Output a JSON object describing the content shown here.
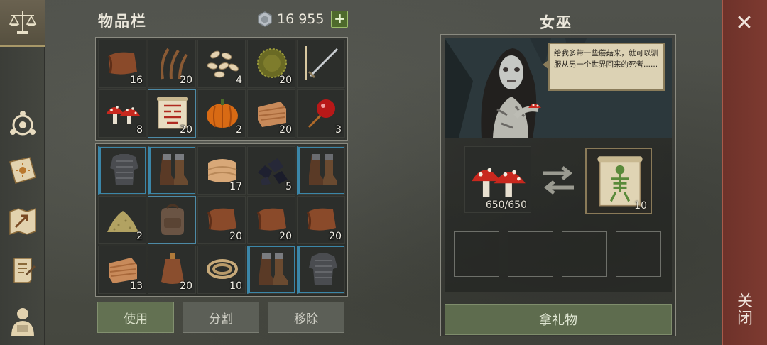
{
  "sidebar": {
    "items": [
      {
        "name": "trade-scales-icon",
        "active": true
      },
      {
        "name": "clan-emblem-icon"
      },
      {
        "name": "sun-book-icon"
      },
      {
        "name": "map-arrow-icon"
      },
      {
        "name": "quest-scroll-icon"
      },
      {
        "name": "character-icon"
      }
    ]
  },
  "inventory": {
    "title": "物品栏",
    "currency": {
      "icon": "silver-coin-icon",
      "amount": "16 955",
      "add_label": "+"
    },
    "bag_slots": [
      {
        "icon": "leather-icon",
        "qty": "16"
      },
      {
        "icon": "branches-icon",
        "qty": "20"
      },
      {
        "icon": "seeds-icon",
        "qty": "4"
      },
      {
        "icon": "grass-bundle-icon",
        "qty": "20"
      },
      {
        "icon": "sword-icon",
        "qty": ""
      },
      {
        "icon": "red-mushroom-icon",
        "qty": "8"
      },
      {
        "icon": "blueprint-scroll-icon",
        "qty": "20",
        "selected": true
      },
      {
        "icon": "pumpkin-icon",
        "qty": "2"
      },
      {
        "icon": "cloth-icon",
        "qty": "20"
      },
      {
        "icon": "candy-apple-icon",
        "qty": "3"
      }
    ],
    "pack_slots": [
      {
        "icon": "chain-armor-icon",
        "qty": "",
        "equipped": true
      },
      {
        "icon": "boots-icon",
        "qty": "",
        "equipped": true
      },
      {
        "icon": "fabric-icon",
        "qty": "17"
      },
      {
        "icon": "coal-icon",
        "qty": "5"
      },
      {
        "icon": "boots-icon",
        "qty": "",
        "equipped": true
      },
      {
        "icon": "sand-pile-icon",
        "qty": "2"
      },
      {
        "icon": "backpack-icon",
        "qty": "",
        "selected": true
      },
      {
        "icon": "leather-icon",
        "qty": "20"
      },
      {
        "icon": "leather-icon",
        "qty": "20"
      },
      {
        "icon": "leather-icon",
        "qty": "20"
      },
      {
        "icon": "cloth-icon",
        "qty": "13"
      },
      {
        "icon": "flask-icon",
        "qty": "20"
      },
      {
        "icon": "rope-icon",
        "qty": "10"
      },
      {
        "icon": "boots-icon",
        "qty": "",
        "equipped": true
      },
      {
        "icon": "chain-armor-icon",
        "qty": "",
        "equipped": true
      }
    ],
    "buttons": {
      "use": "使用",
      "split": "分割",
      "remove": "移除"
    }
  },
  "witch": {
    "title": "女巫",
    "dialogue": "给我多带一些蘑菇来，就可以驯服从另一个世界回来的死者......",
    "trade": {
      "give": {
        "icon": "red-mushroom-icon",
        "qty": "650/650"
      },
      "receive": {
        "icon": "skeleton-scroll-icon",
        "qty": "10"
      }
    },
    "empty_slots": 4,
    "gift_button": "拿礼物"
  },
  "close": {
    "x": "✕",
    "label": "关闭"
  },
  "colors": {
    "equip_border": "#3b86a8",
    "green_button": "#637152",
    "close_bg": "#7d3a30"
  }
}
